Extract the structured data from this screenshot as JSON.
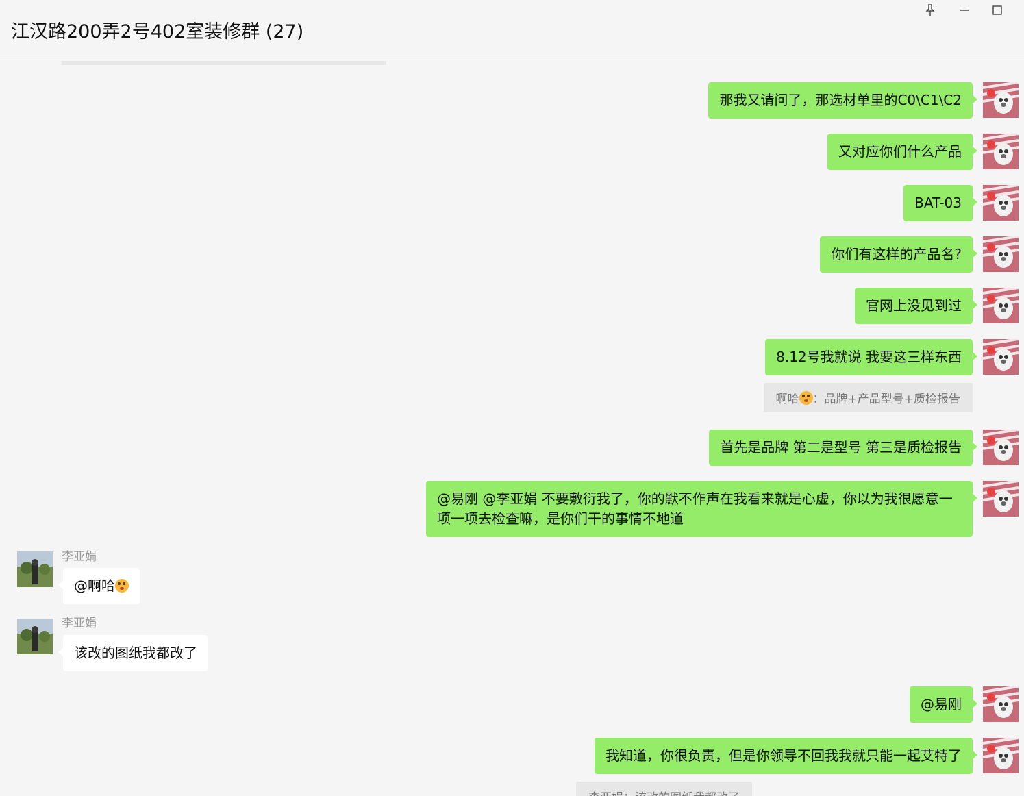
{
  "window": {
    "title": "江汉路200弄2号402室装修群 (27)",
    "controls": {
      "pin": "pin-icon",
      "minimize": "minimize-icon",
      "maximize": "maximize-icon"
    }
  },
  "colors": {
    "self_bubble": "#95ec69",
    "other_bubble": "#ffffff",
    "quote_bg": "#e7e7e7",
    "background": "#f5f5f5"
  },
  "messages": {
    "m1": "那我又请问了，那选材单里的C0\\C1\\C2",
    "m2": "又对应你们什么产品",
    "m3": "BAT-03",
    "m4": "你们有这样的产品名?",
    "m5": "官网上没见到过",
    "m6": "8.12号我就说 我要这三样东西",
    "q6": {
      "sender": "啊哈",
      "emoji": "flushed-emoji",
      "text": "：品牌+产品型号+质检报告"
    },
    "m7": "首先是品牌 第二是型号 第三是质检报告",
    "m8": "@易刚 @李亚娟 不要敷衍我了，你的默不作声在我看来就是心虚，你以为我很愿意一项一项去检查嘛，是你们干的事情不地道",
    "o1": {
      "sender": "李亚娟",
      "text": "@啊哈",
      "emoji": "flushed-emoji"
    },
    "o2": {
      "sender": "李亚娟",
      "text": "该改的图纸我都改了"
    },
    "m9": "@易刚",
    "m10": "我知道，你很负责，但是你领导不回我我就只能一起艾特了",
    "q10": "李亚娟：该改的图纸我都改了"
  }
}
